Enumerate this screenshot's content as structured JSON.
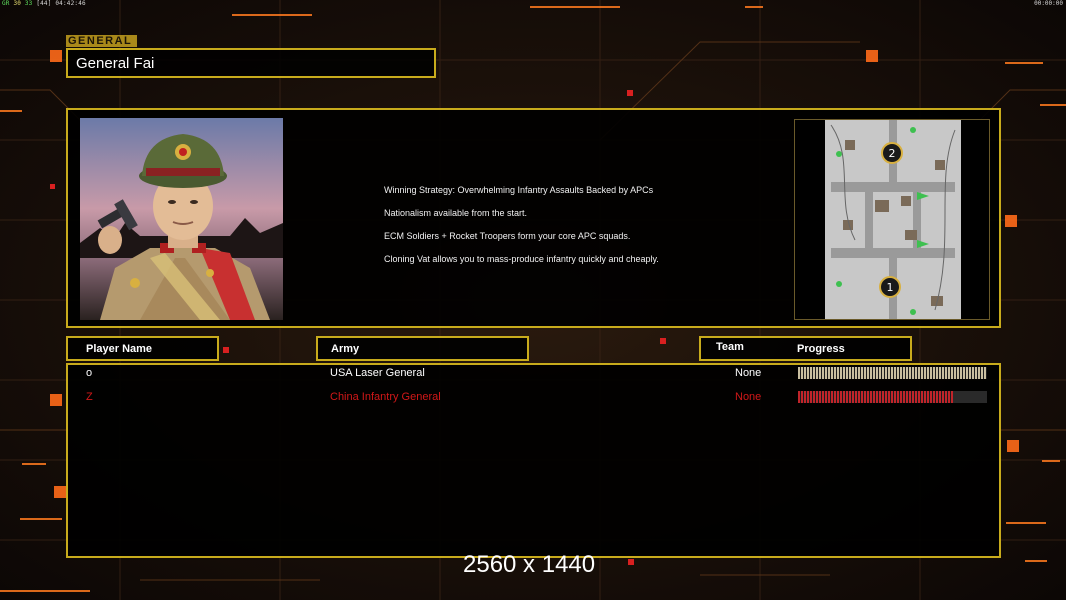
{
  "hud": {
    "stats_gr": "GR",
    "stats_a": "30",
    "stats_b": "33",
    "stats_c": "[44]",
    "clock": "04:42:46",
    "timer": "00:00:00"
  },
  "general": {
    "tag": "GENERAL",
    "name": "General Fai",
    "portrait_icon": "general-portrait",
    "strategy": [
      "Winning Strategy: Overwhelming Infantry Assaults Backed by APCs",
      "Nationalism available from the start.",
      "ECM Soldiers + Rocket Troopers form your core APC squads.",
      "Cloning Vat allows you to mass-produce infantry quickly and cheaply."
    ],
    "map_icon": "map-preview",
    "map_markers": [
      "2",
      "1"
    ]
  },
  "table": {
    "headers": {
      "player_name": "Player Name",
      "army": "Army",
      "team": "Team",
      "progress": "Progress"
    },
    "rows": [
      {
        "name": "o",
        "army": "USA Laser General",
        "team": "None",
        "progress": 1.0,
        "color": "#ffffff",
        "bar_color": "#c9bfa0"
      },
      {
        "name": "Z",
        "army": "China Infantry General",
        "team": "None",
        "progress": 0.82,
        "color": "#d21818",
        "bar_color": "#c0242a"
      }
    ]
  },
  "footer": {
    "resolution": "2560 x 1440"
  },
  "colors": {
    "frame": "#c8ab1c",
    "accent": "#ff6a1a",
    "background": "#120c08"
  }
}
